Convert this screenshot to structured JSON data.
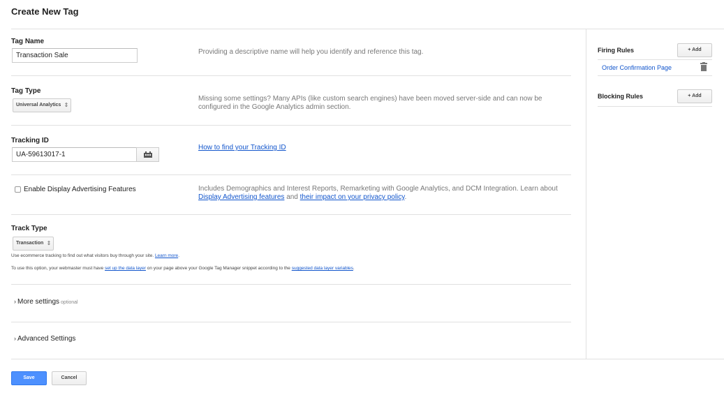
{
  "page": {
    "title": "Create New Tag"
  },
  "tag_name": {
    "label": "Tag Name",
    "value": "Transaction Sale",
    "hint": "Providing a descriptive name will help you identify and reference this tag."
  },
  "tag_type": {
    "label": "Tag Type",
    "selected": "Universal Analytics",
    "hint": "Missing some settings? Many APIs (like custom search engines) have been moved server-side and can now be configured in the Google Analytics admin section."
  },
  "tracking_id": {
    "label": "Tracking ID",
    "value": "UA-59613017-1",
    "help_link": "How to find your Tracking ID"
  },
  "display_advertising": {
    "checkbox_label": "Enable Display Advertising Features",
    "checked": false,
    "hint_prefix": "Includes Demographics and Interest Reports, Remarketing with Google Analytics, and DCM Integration. Learn about",
    "link1": "Display Advertising features",
    "hint_mid": "and",
    "link2": "their impact on your privacy policy",
    "hint_end": "."
  },
  "track_type": {
    "label": "Track Type",
    "selected": "Transaction",
    "line1_text": "Use ecommerce tracking to find out what visitors buy through your site.",
    "line1_link": "Learn more",
    "line2_prefix": "To use this option, your webmaster must have",
    "line2_link1": "set up the data layer",
    "line2_mid": "on your page above your Google Tag Manager snippet according to the",
    "line2_link2": "suggested data layer variables",
    "line2_end": "."
  },
  "more_settings": {
    "label": "More settings",
    "optional": "optional"
  },
  "advanced_settings": {
    "label": "Advanced Settings"
  },
  "footer": {
    "save_label": "Save",
    "cancel_label": "Cancel"
  },
  "sidebar": {
    "firing_rules": {
      "title": "Firing Rules",
      "add_label": "+ Add",
      "items": [
        "Order Confirmation Page"
      ]
    },
    "blocking_rules": {
      "title": "Blocking Rules",
      "add_label": "+ Add"
    }
  },
  "colors": {
    "accent": "#4d90fe",
    "link": "#1155cc",
    "divider": "#e0e0e0"
  },
  "icons": {
    "calendar": "calendar-icon",
    "trash": "trash-icon",
    "chevron": "chevron-right-icon",
    "select_arrows": "select-arrows-icon"
  }
}
